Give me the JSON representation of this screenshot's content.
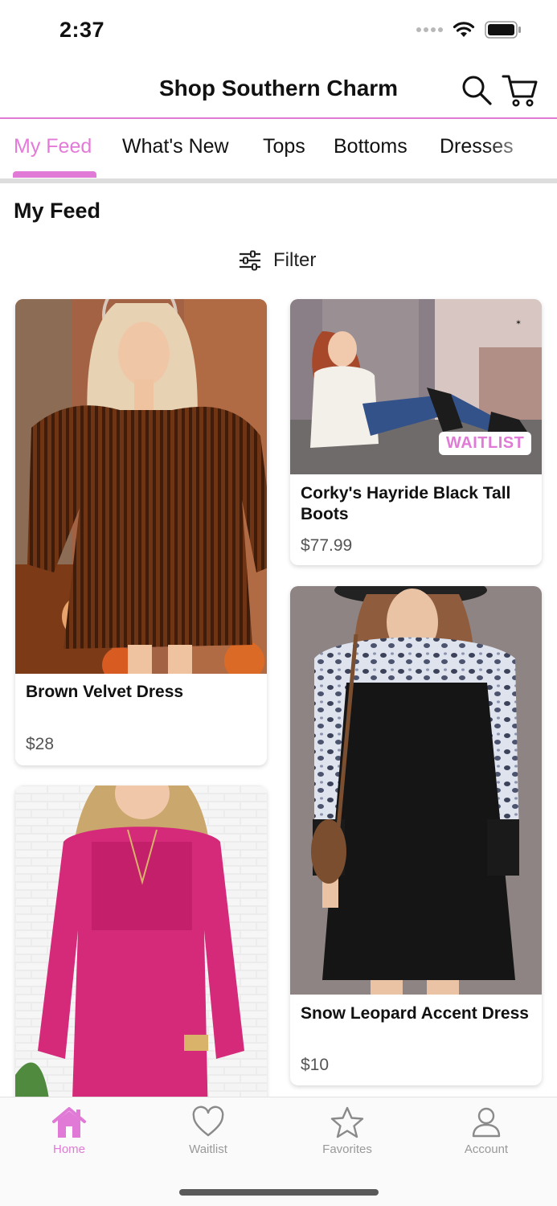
{
  "status": {
    "time": "2:37"
  },
  "header": {
    "title": "Shop Southern Charm"
  },
  "tabs": [
    {
      "label": "My Feed"
    },
    {
      "label": "What's New"
    },
    {
      "label": "Tops"
    },
    {
      "label": "Bottoms"
    },
    {
      "label": "Dresses"
    }
  ],
  "feed": {
    "title": "My Feed",
    "filter_label": "Filter",
    "products": [
      {
        "name": "Brown Velvet Dress",
        "price": "$28"
      },
      {
        "name": "Corky's Hayride Black Tall Boots",
        "price": "$77.99",
        "badge": "WAITLIST"
      },
      {
        "name": "Snow Leopard Accent Dress",
        "price": "$10"
      },
      {
        "name": "",
        "price": ""
      }
    ]
  },
  "bottom_nav": [
    {
      "label": "Home",
      "icon": "home-icon"
    },
    {
      "label": "Waitlist",
      "icon": "heart-icon"
    },
    {
      "label": "Favorites",
      "icon": "star-icon"
    },
    {
      "label": "Account",
      "icon": "person-icon"
    }
  ],
  "colors": {
    "accent": "#e07ad6",
    "text": "#111111",
    "muted": "#999999"
  }
}
